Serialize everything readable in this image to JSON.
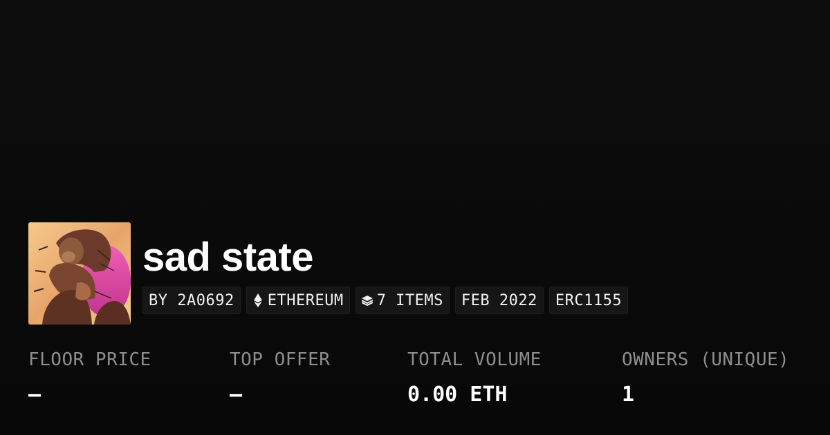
{
  "collection": {
    "name": "sad state",
    "avatar_alt": "ape artwork"
  },
  "pills": {
    "creator": "BY 2A0692",
    "chain": "ETHEREUM",
    "chain_icon": "ethereum-icon",
    "items": "7 ITEMS",
    "items_icon": "layers-icon",
    "date": "FEB 2022",
    "standard": "ERC1155"
  },
  "stats": {
    "floor_price": {
      "label": "FLOOR PRICE",
      "value": "–"
    },
    "top_offer": {
      "label": "TOP OFFER",
      "value": "–"
    },
    "total_volume": {
      "label": "TOTAL VOLUME",
      "value": "0.00 ETH"
    },
    "owners": {
      "label": "OWNERS (UNIQUE)",
      "value": "1"
    }
  },
  "colors": {
    "background": "#0b0b0b",
    "pill_background": "#161616",
    "label_gray": "#8e8e8e",
    "text_white": "#ffffff"
  }
}
